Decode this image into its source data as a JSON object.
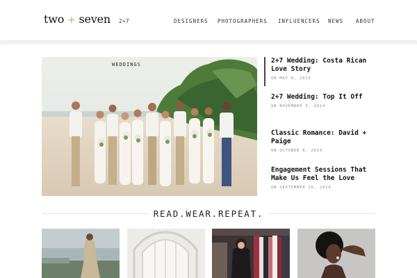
{
  "header": {
    "logo": {
      "left": "two",
      "plus": "+",
      "right": "seven"
    },
    "tagline": "2+7",
    "nav": [
      "DESIGNERS",
      "PHOTOGRAPHERS",
      "INFLUENCERS",
      "NEWS",
      "ABOUT"
    ]
  },
  "hero": {
    "tag": "WEDDINGS"
  },
  "posts": [
    {
      "title": "2+7 Wedding: Costa Rican Love Story",
      "date": "ON MAY 8, 2015"
    },
    {
      "title": "2+7 Wedding: Top It Off",
      "date": "ON NOVEMBER 5, 2014"
    },
    {
      "title": "Classic Romance: David + Paige",
      "date": "ON OCTOBER 8, 2014"
    },
    {
      "title": "Engagement Sessions That Make Us Feel the Love",
      "date": "ON SEPTEMBER 26, 2014"
    }
  ],
  "section": {
    "title": "READ.WEAR.REPEAT."
  },
  "colors": {
    "accent": "#c9a64a",
    "text": "#1a1a1a",
    "muted": "#888888"
  }
}
